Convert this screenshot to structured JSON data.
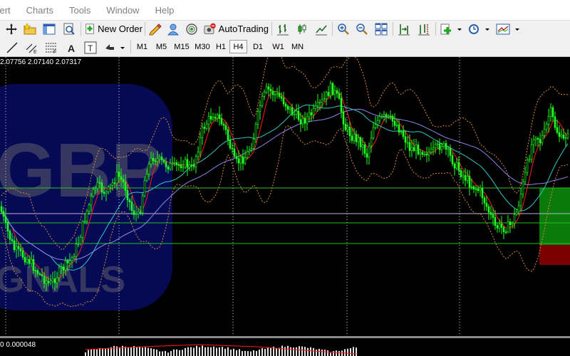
{
  "menu": [
    "Insert",
    "Charts",
    "Tools",
    "Window",
    "Help"
  ],
  "menu_visible": [
    "sert",
    "Charts",
    "Tools",
    "Window",
    "Help"
  ],
  "toolbar": {
    "new_order_label": "New Order",
    "autotrading_label": "AutoTrading"
  },
  "timeframes": [
    "M1",
    "M5",
    "M15",
    "M30",
    "H1",
    "H4",
    "D1",
    "W1",
    "MN"
  ],
  "active_timeframe": "H4",
  "chart": {
    "ohlc_text": "2.07756 2.07140 2.07317",
    "watermark_title": "GBP",
    "watermark_subtitle": "GNALS",
    "colors": {
      "background": "#000000",
      "candles": "#22ff22",
      "ma_fast": "#ff1a1a",
      "ma_mid": "#2fc7c7",
      "ma_slow": "#8a86e8",
      "bands": "#d98a3a",
      "level_lines": "#21c421",
      "level_gray": "#b9b9d6",
      "buy_zone": "#0a7a0a",
      "sell_zone": "#7a0000"
    }
  },
  "indicator": {
    "label_text": "0 0.000048"
  }
}
